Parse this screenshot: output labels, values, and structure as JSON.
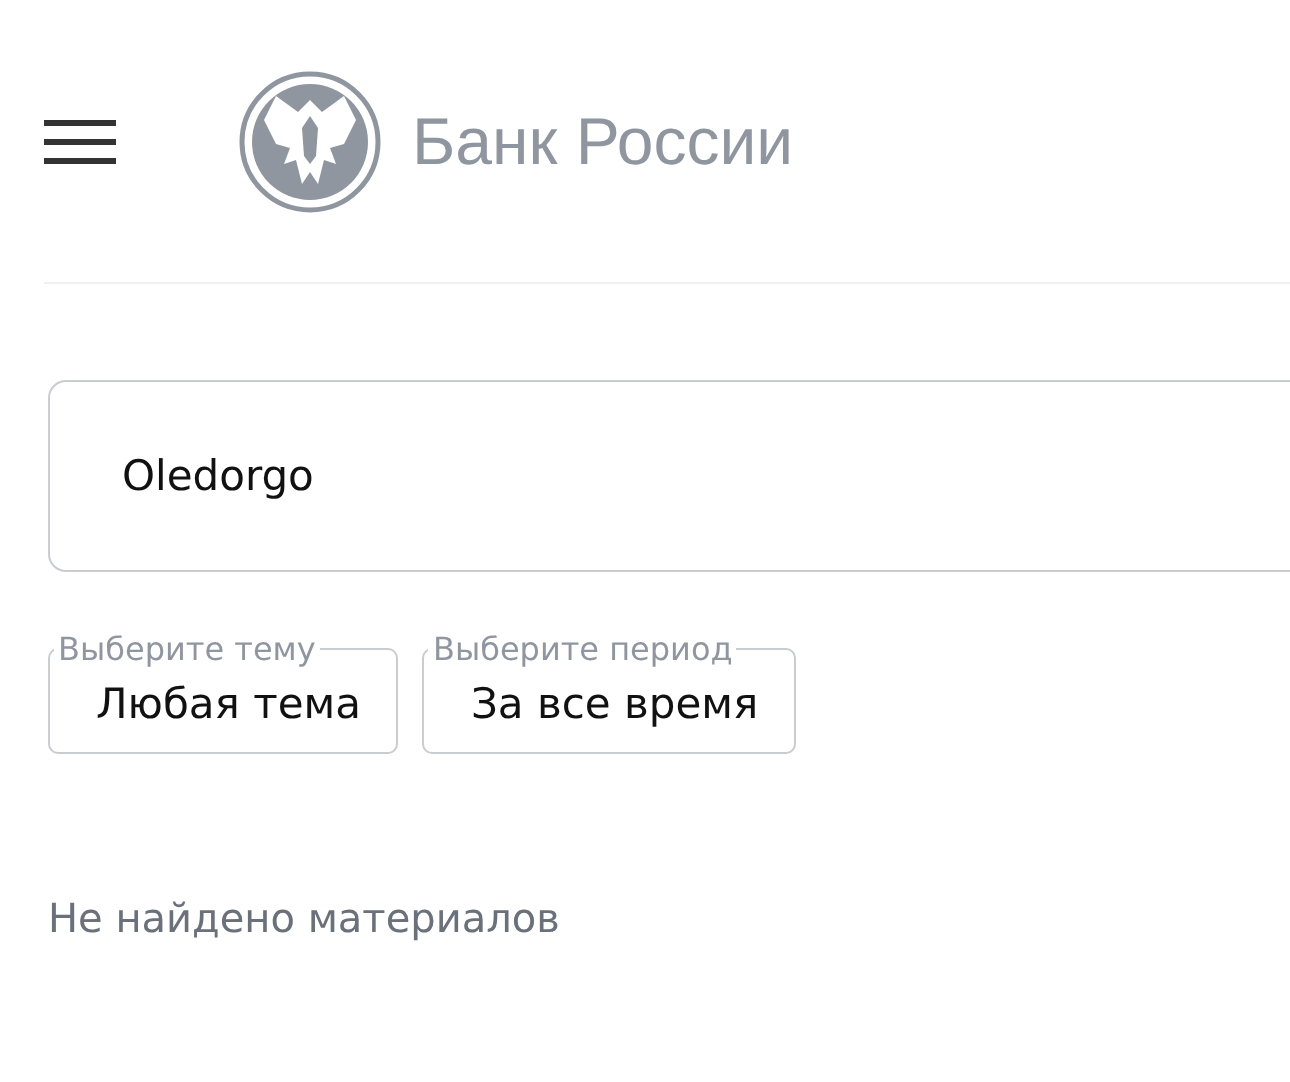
{
  "header": {
    "logo_text": "Банк России"
  },
  "search": {
    "value": "Oledorgo"
  },
  "filters": [
    {
      "label": "Выберите тему",
      "value": "Любая тема"
    },
    {
      "label": "Выберите период",
      "value": "За все время"
    }
  ],
  "empty_message": "Не найдено материалов"
}
